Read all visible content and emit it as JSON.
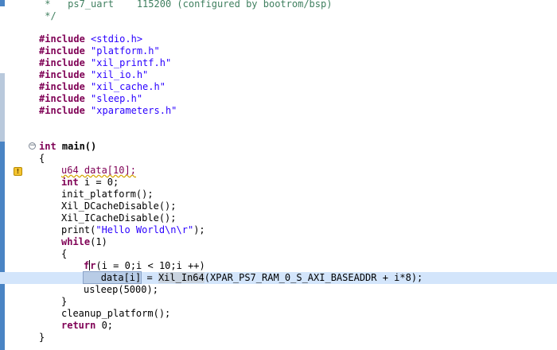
{
  "editor": {
    "lines": [
      {
        "id": "cm1",
        "text": " *   ps7_uart    115200 (configured by bootrom/bsp)"
      },
      {
        "id": "cm2",
        "text": " */"
      },
      {
        "id": "inc1_kw",
        "text": "#include"
      },
      {
        "id": "inc1_f",
        "text": " <stdio.h>"
      },
      {
        "id": "inc2_kw",
        "text": "#include"
      },
      {
        "id": "inc2_f",
        "text": " \"platform.h\""
      },
      {
        "id": "inc3_kw",
        "text": "#include"
      },
      {
        "id": "inc3_f",
        "text": " \"xil_printf.h\""
      },
      {
        "id": "inc4_kw",
        "text": "#include"
      },
      {
        "id": "inc4_f",
        "text": " \"xil_io.h\""
      },
      {
        "id": "inc5_kw",
        "text": "#include"
      },
      {
        "id": "inc5_f",
        "text": " \"xil_cache.h\""
      },
      {
        "id": "inc6_kw",
        "text": "#include"
      },
      {
        "id": "inc6_f",
        "text": " \"sleep.h\""
      },
      {
        "id": "inc7_kw",
        "text": "#include"
      },
      {
        "id": "inc7_f",
        "text": " \"xparameters.h\""
      }
    ],
    "main_sig_type": "int",
    "main_sig_name": " main()",
    "brace_open": "{",
    "decl_data": "u64 data[10];",
    "decl_i_type": "int",
    "decl_i_rest": " i = 0;",
    "init_platform": "init_platform();",
    "dcache": "Xil_DCacheDisable();",
    "icache": "Xil_ICacheDisable();",
    "print_fn": "print(",
    "print_str": "\"Hello World\\n\\r\"",
    "print_end": ");",
    "while_kw": "while",
    "while_rest": "(1)",
    "inner_open": "{",
    "for_kw_a": "f",
    "for_kw_b": "r",
    "for_rest": "(i = 0;i < 10;i ++)",
    "assign_sel": "data[i]",
    "assign_eq": " = ",
    "assign_fn": "Xil_In64",
    "assign_rest": "(XPAR_PS7_RAM_0_S_AXI_BASEADDR + i*8);",
    "usleep": "usleep(5000);",
    "inner_close": "}",
    "cleanup": "cleanup_platform();",
    "return_kw": "return",
    "return_rest": " 0;",
    "brace_close": "}",
    "warning_marker": "!",
    "fold_symbol": "−"
  },
  "colors": {
    "comment": "#3f7f5f",
    "keyword": "#7f0055",
    "string": "#2a00ff",
    "current_line": "#d3e5fb",
    "ruler_strip": "#4a84c4"
  }
}
